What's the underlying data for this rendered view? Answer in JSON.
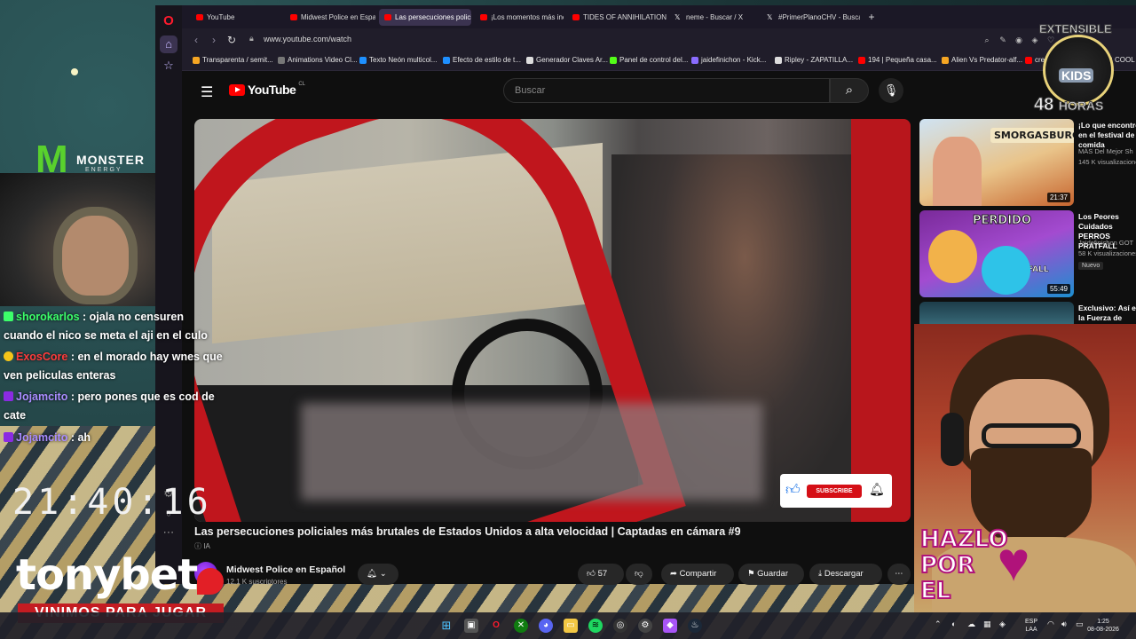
{
  "browser": {
    "tabs": [
      {
        "label": "YouTube",
        "icon": "youtube-icon"
      },
      {
        "label": "Midwest Police en Españo",
        "icon": "youtube-icon"
      },
      {
        "label": "Las persecuciones policiales",
        "icon": "youtube-icon",
        "active": true
      },
      {
        "label": "¡Los momentos más incre",
        "icon": "youtube-icon"
      },
      {
        "label": "TIDES OF ANNIHILATION",
        "icon": "youtube-icon"
      },
      {
        "label": "neme - Buscar / X",
        "icon": "x-icon"
      },
      {
        "label": "#PrimerPlanoCHV - Busca",
        "icon": "x-icon"
      }
    ],
    "url": "www.youtube.com/watch",
    "bookmarks": [
      {
        "label": "Transparenta / semit...",
        "color": "#f5a623"
      },
      {
        "label": "Animations Video Cl...",
        "color": "#777777"
      },
      {
        "label": "Texto Neón multicol...",
        "color": "#1e90ff"
      },
      {
        "label": "Efecto de estilo de t...",
        "color": "#1e90ff"
      },
      {
        "label": "Generador Claves Ar...",
        "color": "#dddddd"
      },
      {
        "label": "Panel de control del...",
        "color": "#53fc18"
      },
      {
        "label": "jaidefinichon - Kick...",
        "color": "#8a6cff"
      },
      {
        "label": "Ripley - ZAPATILLA...",
        "color": "#dddddd"
      },
      {
        "label": "194 | Pequeña casa...",
        "color": "#ff0000"
      },
      {
        "label": "Alien Vs Predator-alf...",
        "color": "#f5a623"
      },
      {
        "label": "cre",
        "color": "#ff0000"
      },
      {
        "label": "COOL",
        "color": "#dddddd"
      }
    ]
  },
  "youtube": {
    "logo_text": "YouTube",
    "region": "CL",
    "search_placeholder": "Buscar",
    "video": {
      "title": "Las persecuciones policiales más brutales de Estados Unidos a alta velocidad | Captadas en cámara #9",
      "ai_badge": "IA",
      "subscribe_overlay": "SUBSCRIBE"
    },
    "channel": {
      "name": "Midwest Police en Español",
      "subscribers": "12,1 K suscriptores"
    },
    "actions": {
      "likes": "57",
      "share": "Compartir",
      "save": "Guardar",
      "download": "Descargar"
    },
    "recommended": [
      {
        "title": "¡Lo que encontré en el festival de comida",
        "channel": "MÁS Del Mejor Sh",
        "views": "145 K visualizaciones",
        "duration": "21:37",
        "thumb_text": "SMORGASBURG"
      },
      {
        "title": "Los Peores Cuidados PERROS PRATFALL",
        "channel": "Jaidefinichon GOT",
        "views": "58 K visualizaciones",
        "duration": "55:49",
        "badge": "Nuevo",
        "thumb_text": "PERDIDO",
        "thumb_text2": "PRATFALL"
      },
      {
        "title": "Exclusivo: Así es la Fuerza de Subm",
        "channel": "",
        "views": "",
        "duration": ""
      }
    ]
  },
  "stream": {
    "chat": [
      {
        "user": "shorokarlos",
        "text": "ojala no censuren cuando el nico se meta el aji en el culo",
        "user_color": "#3cff6a",
        "badge_color": "#3cff6a"
      },
      {
        "user": "ExosCore",
        "text": "en el morado hay wnes que ven peliculas enteras",
        "user_color": "#ff3b3b",
        "badge_color": "#f5c518"
      },
      {
        "user": "Jojamcito",
        "text": "pero pones que es cod de cate",
        "user_color": "#a98cff",
        "badge_color": "#8a2be2"
      },
      {
        "user": "Jojamcito",
        "text": "ah",
        "user_color": "#a98cff",
        "badge_color": "#8a2be2"
      }
    ],
    "clock": "21:40:16",
    "sponsor": "tonybet",
    "sponsor_tagline": "VINIMOS PARA JUGAR",
    "monster_brand": "MONSTER",
    "monster_sub": "ENERGY",
    "overlay_text": [
      "HAZLO",
      "POR",
      "EL"
    ],
    "kids_badge": {
      "top": "EXTENSIBLE",
      "middle": "KIDS",
      "bottom_num": "48",
      "bottom_word": "HORAS"
    }
  },
  "taskbar": {
    "language": "ESP",
    "region": "LAA",
    "time": "1:25",
    "date": "08-08-2026"
  }
}
